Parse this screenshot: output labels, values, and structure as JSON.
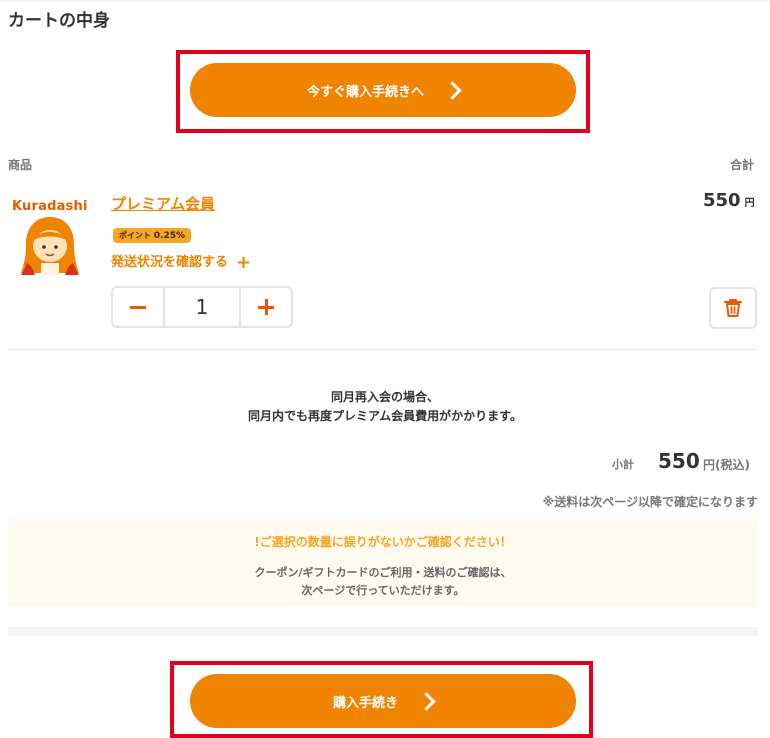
{
  "title": "カートの中身",
  "top_button": {
    "label": "今すぐ購入手続きへ"
  },
  "columns": {
    "product": "商品",
    "total": "合計"
  },
  "product": {
    "logo_text": "Kuradashi",
    "name": "プレミアム会員",
    "price": "550",
    "price_unit": "円",
    "point_label": "ポイント",
    "point_value": "0.25%",
    "shipping_link": "発送状況を確認する",
    "quantity": "1"
  },
  "notice": {
    "line1": "同月再入会の場合、",
    "line2": "同月内でも再度プレミアム会員費用がかかります。"
  },
  "subtotal": {
    "label": "小計",
    "value": "550",
    "unit": "円(税込)"
  },
  "shipping_note": "※送料は次ページ以降で確定になります",
  "warning": {
    "title": "!ご選択の数量に誤りがないかご確認ください！",
    "line1": "クーポン/ギフトカードのご利用・送料のご確認は、",
    "line2": "次ページで行っていただけます。"
  },
  "bottom_button": {
    "label": "購入手続き"
  },
  "colors": {
    "accent": "#f08300",
    "highlight_frame": "#e3001b",
    "warning_text": "#f5a623"
  }
}
